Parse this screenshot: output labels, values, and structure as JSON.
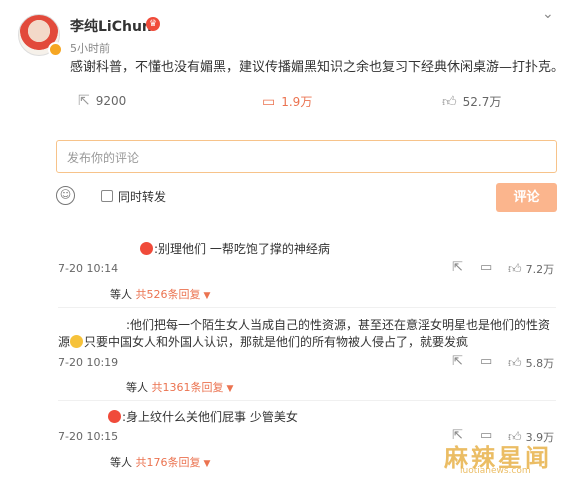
{
  "author": {
    "name": "李纯LiChun",
    "time": "5小时前"
  },
  "post": {
    "content": "感谢科普，不懂也没有媚黑，建议传播媚黑知识之余也复习下经典休闲桌游—打扑克。"
  },
  "actions": {
    "forward": {
      "icon": "forward-icon",
      "count": "9200"
    },
    "comment": {
      "icon": "comment-icon",
      "count": "1.9万"
    },
    "like": {
      "icon": "like-icon",
      "count": "52.7万"
    }
  },
  "composer": {
    "placeholder": "发布你的评论",
    "forward_label": "同时转发",
    "submit_label": "评论"
  },
  "comments": [
    {
      "text": ":别理他们 一帮吃饱了撑的神经病",
      "time": "7-20 10:14",
      "likes": "7.2万",
      "reply_prefix": "等人",
      "reply_link": "共526条回复"
    },
    {
      "text_line1": ":他们把每一个陌生女人当成自己的性资源，甚至还在意淫女明星也是他们的性资",
      "text_line2": "源",
      "text_line2_rest": "只要中国女人和外国人认识，那就是他们的所有物被人侵占了，就要发疯",
      "time": "7-20 10:19",
      "likes": "5.8万",
      "reply_prefix": "等人",
      "reply_link": "共1361条回复"
    },
    {
      "text": ":身上纹什么关他们屁事 少管美女",
      "time": "7-20 10:15",
      "likes": "3.9万",
      "reply_prefix": "等人",
      "reply_link": "共176条回复"
    }
  ],
  "watermark": {
    "title": "麻辣星闻",
    "url": "luotianews.com"
  },
  "colors": {
    "accent": "#eb7350",
    "submit_bg": "#fbb58d",
    "input_border": "#f7c38a"
  }
}
